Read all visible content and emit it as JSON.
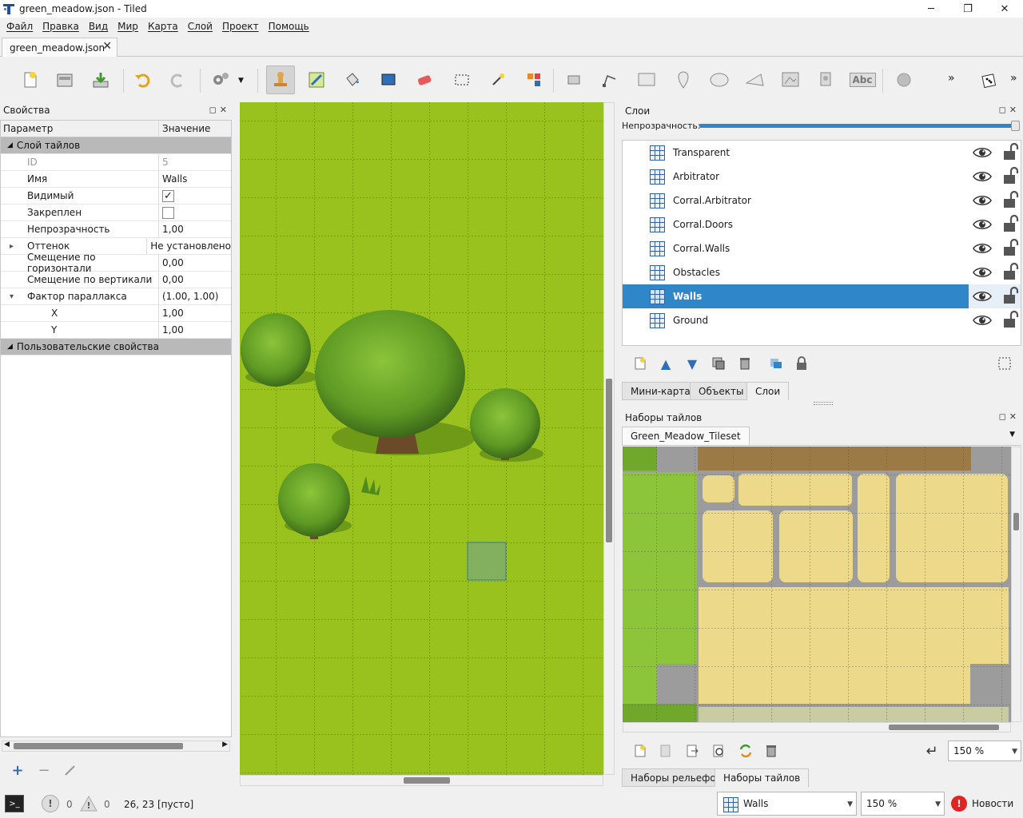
{
  "window": {
    "title": "green_meadow.json - Tiled",
    "minimize": "─",
    "maximize": "❐",
    "close": "✕"
  },
  "menu": [
    "Файл",
    "Правка",
    "Вид",
    "Мир",
    "Карта",
    "Слой",
    "Проект",
    "Помощь"
  ],
  "document_tab": {
    "label": "green_meadow.json",
    "close": "✕"
  },
  "toolbar": {
    "buttons": [
      "new-map",
      "open",
      "save",
      "undo",
      "redo",
      "commands",
      "stamp-brush",
      "terrain-brush",
      "bucket-fill",
      "shape-fill",
      "eraser",
      "rect-select",
      "magic-wand",
      "select-same-tile",
      "select-objects",
      "edit-polygons",
      "insert-rectangle",
      "insert-point",
      "insert-ellipse",
      "insert-polygon",
      "insert-tile",
      "insert-template",
      "insert-text",
      "world-tool",
      "random-mode"
    ],
    "active": "stamp-brush",
    "text_tool_label": "Abc",
    "overflow": "»"
  },
  "properties": {
    "title": "Свойства",
    "col_param": "Параметр",
    "col_value": "Значение",
    "group_tile_layer": "Слой тайлов",
    "rows": [
      {
        "key": "ID",
        "value": "5",
        "disabled": true
      },
      {
        "key": "Имя",
        "value": "Walls"
      },
      {
        "key": "Видимый",
        "value": "",
        "checkbox": true,
        "checked": true
      },
      {
        "key": "Закреплен",
        "value": "",
        "checkbox": true,
        "checked": false
      },
      {
        "key": "Непрозрачность",
        "value": "1,00"
      },
      {
        "key": "Оттенок",
        "value": "Не установлено",
        "expander": "▸"
      },
      {
        "key": "Смещение по горизонтали",
        "value": "0,00"
      },
      {
        "key": "Смещение по вертикали",
        "value": "0,00"
      },
      {
        "key": "Фактор параллакса",
        "value": "(1.00, 1.00)",
        "expander": "▾"
      },
      {
        "key": "X",
        "value": "1,00",
        "sub": true
      },
      {
        "key": "Y",
        "value": "1,00",
        "sub": true
      }
    ],
    "group_custom": "Пользовательские свойства",
    "actions": [
      "add-property",
      "remove-property",
      "rename-property"
    ]
  },
  "layers": {
    "title": "Слои",
    "opacity_label": "Непрозрачность:",
    "opacity": 1.0,
    "items": [
      {
        "name": "Transparent",
        "selected": false
      },
      {
        "name": "Arbitrator",
        "selected": false
      },
      {
        "name": "Corral.Arbitrator",
        "selected": false
      },
      {
        "name": "Corral.Doors",
        "selected": false
      },
      {
        "name": "Corral.Walls",
        "selected": false
      },
      {
        "name": "Obstacles",
        "selected": false
      },
      {
        "name": "Walls",
        "selected": true
      },
      {
        "name": "Ground",
        "selected": false
      }
    ],
    "tabs": [
      "Мини-карта",
      "Объекты",
      "Слои"
    ],
    "active_tab": "Слои"
  },
  "tilesets": {
    "title": "Наборы тайлов",
    "current": "Green_Meadow_Tileset",
    "zoom": "150 %",
    "tabs": [
      "Наборы рельефов",
      "Наборы тайлов"
    ],
    "active_tab": "Наборы тайлов"
  },
  "status": {
    "errors": "0",
    "warnings": "0",
    "cursor": "26, 23 [пусто]",
    "layer": "Walls",
    "zoom": "150 %",
    "news": "Новости"
  },
  "colors": {
    "grass": "#9ac21e",
    "selection": "#2f86c9",
    "panel": "#f0f0f0",
    "group": "#b9b9b9"
  }
}
